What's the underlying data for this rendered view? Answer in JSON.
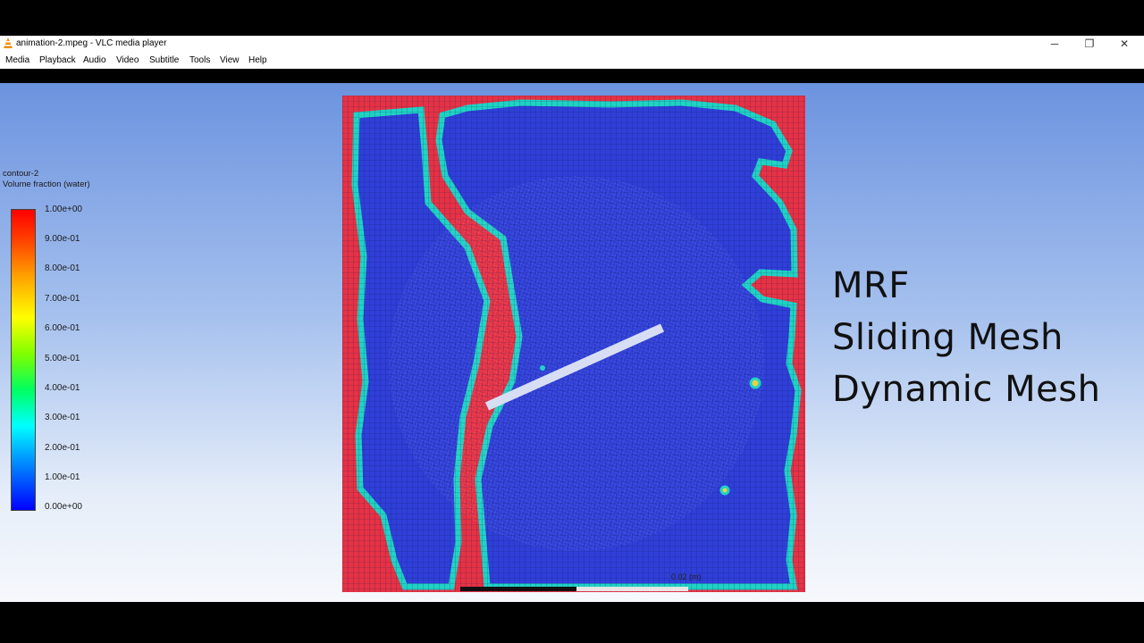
{
  "window": {
    "title": "animation-2.mpeg - VLC media player",
    "minimize_glyph": "─",
    "maximize_glyph": "❐",
    "close_glyph": "✕"
  },
  "menu": [
    "Media",
    "Playback",
    "Audio",
    "Video",
    "Subtitle",
    "Tools",
    "View",
    "Help"
  ],
  "legend": {
    "title": "contour-2",
    "subtitle": "Volume fraction (water)",
    "ticks": [
      "1.00e+00",
      "9.00e-01",
      "8.00e-01",
      "7.00e-01",
      "6.00e-01",
      "5.00e-01",
      "4.00e-01",
      "3.00e-01",
      "2.00e-01",
      "1.00e-01",
      "0.00e+00"
    ]
  },
  "overlay_text": [
    "MRF",
    "Sliding Mesh",
    "Dynamic Mesh"
  ],
  "scale_bar_label": "0.02 (m)",
  "colors": {
    "water": "#e53245",
    "air": "#2f3fd8",
    "interface": "#1fd3c4",
    "background_top": "#6c93df",
    "background_bottom": "#f6f8fc"
  }
}
